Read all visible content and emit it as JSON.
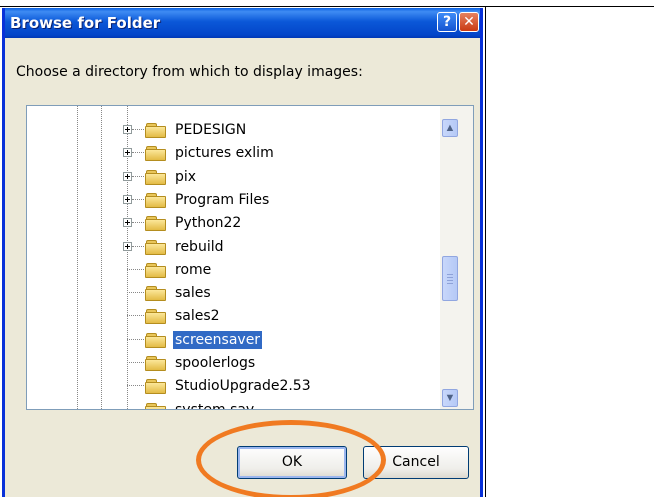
{
  "dialog": {
    "title": "Browse for Folder",
    "help_glyph": "?",
    "close_glyph": "✕",
    "prompt": "Choose a directory from which to display images:"
  },
  "tree": {
    "items": [
      {
        "label": "PEDESIGN",
        "expandable": true,
        "selected": false
      },
      {
        "label": "pictures exlim",
        "expandable": true,
        "selected": false
      },
      {
        "label": "pix",
        "expandable": true,
        "selected": false
      },
      {
        "label": "Program Files",
        "expandable": true,
        "selected": false
      },
      {
        "label": "Python22",
        "expandable": true,
        "selected": false
      },
      {
        "label": "rebuild",
        "expandable": true,
        "selected": false
      },
      {
        "label": "rome",
        "expandable": false,
        "selected": false
      },
      {
        "label": "sales",
        "expandable": false,
        "selected": false
      },
      {
        "label": "sales2",
        "expandable": false,
        "selected": false
      },
      {
        "label": "screensaver",
        "expandable": false,
        "selected": true
      },
      {
        "label": "spoolerlogs",
        "expandable": false,
        "selected": false
      },
      {
        "label": "StudioUpgrade2.53",
        "expandable": false,
        "selected": false
      },
      {
        "label": "system sav",
        "expandable": false,
        "selected": false
      }
    ],
    "scroll_up_glyph": "▲",
    "scroll_down_glyph": "▼"
  },
  "buttons": {
    "ok": "OK",
    "cancel": "Cancel"
  },
  "colors": {
    "titlebar": "#0b58d8",
    "selection": "#316ac5",
    "annotation_circle": "#f07a21",
    "dialog_face": "#ece9d8"
  }
}
